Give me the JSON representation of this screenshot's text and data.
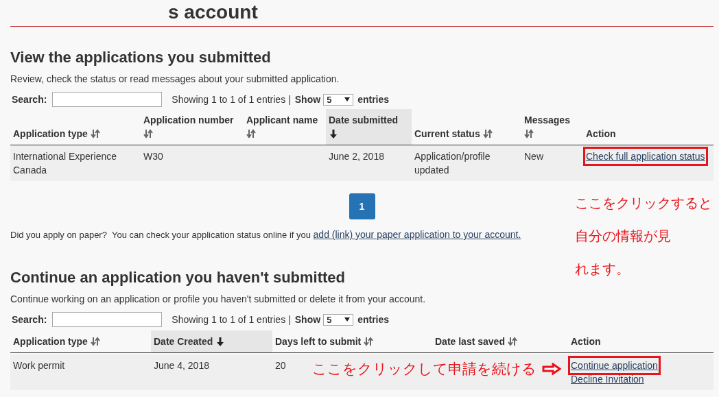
{
  "page_title": "s account",
  "submitted": {
    "heading": "View the applications you submitted",
    "description": "Review, check the status or read messages about your submitted application.",
    "search": {
      "label": "Search:"
    },
    "info": "Showing 1 to 1 of 1 entries",
    "separator": "|",
    "show_label": "Show",
    "page_size": "5",
    "entries_label": "entries",
    "columns": [
      {
        "label": "Application type",
        "sortable": true,
        "sorted": false
      },
      {
        "label": "Application number",
        "sortable": true,
        "sorted": false
      },
      {
        "label": "Applicant name",
        "sortable": true,
        "sorted": false
      },
      {
        "label": "Date submitted",
        "sortable": true,
        "sorted": true
      },
      {
        "label": "Current status",
        "sortable": true,
        "sorted": false
      },
      {
        "label": "Messages",
        "sortable": true,
        "sorted": false
      },
      {
        "label": "Action",
        "sortable": false,
        "sorted": false
      }
    ],
    "rows": [
      {
        "cells": [
          "International Experience Canada",
          "W30",
          "",
          "June 2, 2018",
          "Application/profile updated",
          "New"
        ],
        "actions": [
          {
            "label": "Check full application status",
            "highlighted": true
          }
        ]
      }
    ],
    "pages": [
      {
        "label": "1",
        "selected": true
      }
    ],
    "paper_note": {
      "text": "Did you apply on paper?  You can check your application status online if you ",
      "link": "add (link) your paper application to your account. "
    },
    "annotation_lines": [
      "ここをクリックすると",
      "自分の情報が見",
      "れます。"
    ]
  },
  "unsubmitted": {
    "heading": "Continue an application you haven't submitted",
    "description": "Continue working on an application or profile you haven't submitted or delete it from your account.",
    "search": {
      "label": "Search:"
    },
    "info": "Showing 1 to 1 of 1 entries",
    "separator": "|",
    "show_label": "Show",
    "page_size": "5",
    "entries_label": "entries",
    "columns": [
      {
        "label": "Application type",
        "sortable": true,
        "sorted": false
      },
      {
        "label": "Date Created",
        "sortable": true,
        "sorted": true
      },
      {
        "label": "Days left to submit",
        "sortable": true,
        "sorted": false
      },
      {
        "label": "Date last saved",
        "sortable": true,
        "sorted": false
      },
      {
        "label": "Action",
        "sortable": false,
        "sorted": false
      }
    ],
    "rows": [
      {
        "cells": [
          "Work permit",
          "June 4, 2018",
          "20",
          ""
        ],
        "actions": [
          {
            "label": "Continue application",
            "highlighted": true
          },
          {
            "label": "Decline Invitation",
            "highlighted": false
          }
        ]
      }
    ],
    "annotation": "ここをクリックして申請を続ける"
  }
}
